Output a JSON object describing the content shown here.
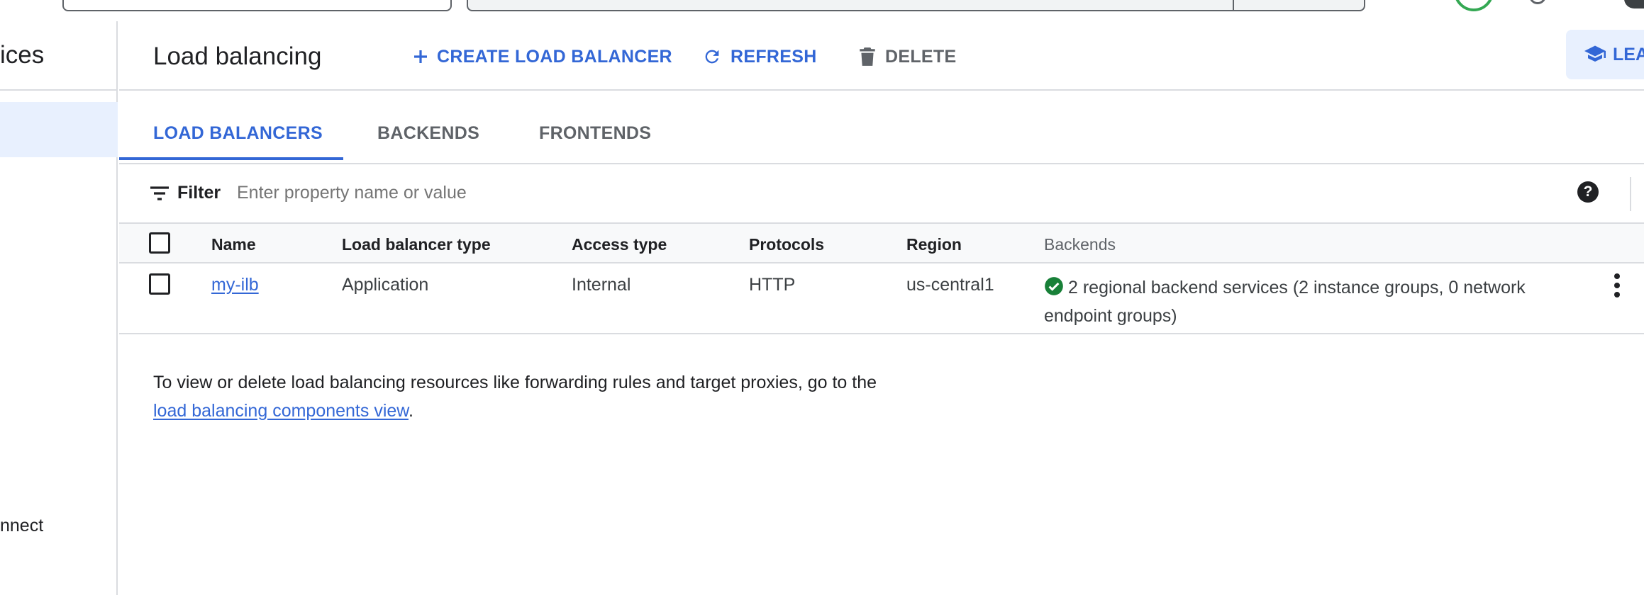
{
  "sidebar": {
    "title_fragment": "ices",
    "bottom_item_fragment": "nnect"
  },
  "header": {
    "title": "Load balancing",
    "actions": {
      "create": "CREATE LOAD BALANCER",
      "refresh": "REFRESH",
      "delete": "DELETE",
      "learn": "LEA"
    }
  },
  "tabs": [
    {
      "label": "LOAD BALANCERS",
      "active": true
    },
    {
      "label": "BACKENDS",
      "active": false
    },
    {
      "label": "FRONTENDS",
      "active": false
    }
  ],
  "filter": {
    "label": "Filter",
    "placeholder": "Enter property name or value"
  },
  "table": {
    "columns": [
      "Name",
      "Load balancer type",
      "Access type",
      "Protocols",
      "Region",
      "Backends"
    ],
    "rows": [
      {
        "name": "my-ilb",
        "type": "Application",
        "access": "Internal",
        "protocols": "HTTP",
        "region": "us-central1",
        "backends": "2 regional backend services (2 instance groups, 0 network endpoint groups)"
      }
    ]
  },
  "info": {
    "text_before": "To view or delete load balancing resources like forwarding rules and target proxies, go to the ",
    "link": "load balancing components view",
    "text_after": "."
  },
  "colors": {
    "accent": "#3367d6",
    "ok": "#188038",
    "text": "#202124"
  }
}
